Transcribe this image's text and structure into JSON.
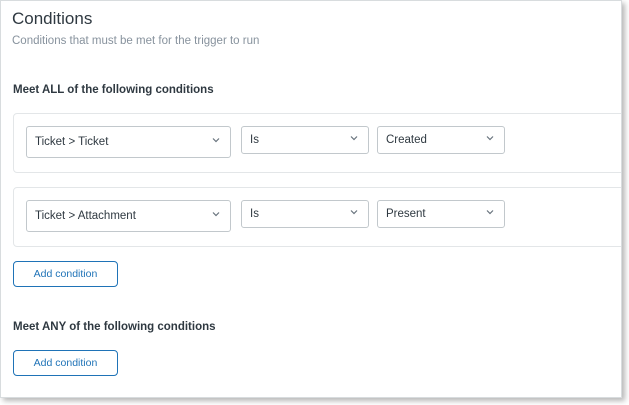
{
  "header": {
    "title": "Conditions",
    "subtitle": "Conditions that must be met for the trigger to run"
  },
  "all_section": {
    "heading": "Meet ALL of the following conditions",
    "rows": [
      {
        "field": "Ticket > Ticket",
        "operator": "Is",
        "value": "Created"
      },
      {
        "field": "Ticket > Attachment",
        "operator": "Is",
        "value": "Present"
      }
    ],
    "add_label": "Add condition"
  },
  "any_section": {
    "heading": "Meet ANY of the following conditions",
    "add_label": "Add condition"
  },
  "icons": {
    "dropdown": "chevron-down-icon"
  },
  "colors": {
    "accent": "#1f73b7",
    "text": "#2f3941",
    "muted": "#87929d",
    "border": "#c2c8cc"
  }
}
